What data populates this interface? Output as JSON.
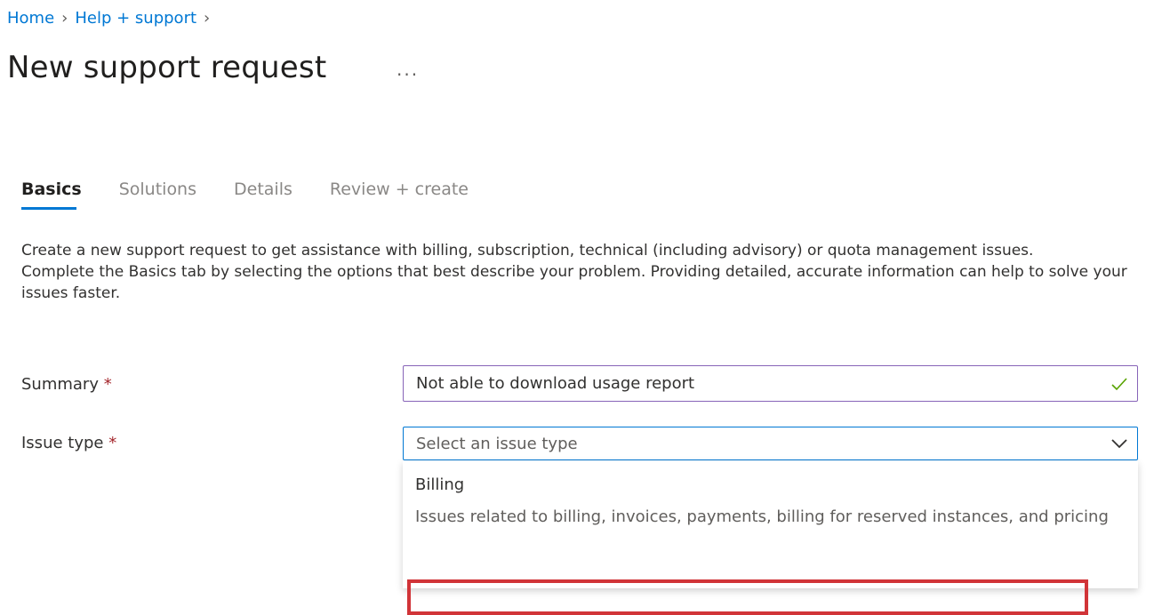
{
  "breadcrumb": {
    "items": [
      "Home",
      "Help + support"
    ],
    "separator": "›"
  },
  "page": {
    "title": "New support request",
    "more_label": "..."
  },
  "tabs": [
    {
      "label": "Basics",
      "active": true
    },
    {
      "label": "Solutions",
      "active": false
    },
    {
      "label": "Details",
      "active": false
    },
    {
      "label": "Review + create",
      "active": false
    }
  ],
  "description": {
    "line1": "Create a new support request to get assistance with billing, subscription, technical (including advisory) or quota management issues.",
    "line2": "Complete the Basics tab by selecting the options that best describe your problem. Providing detailed, accurate information can help to solve your issues faster."
  },
  "form": {
    "summary": {
      "label": "Summary",
      "required_mark": "*",
      "value": "Not able to download usage report"
    },
    "issue_type": {
      "label": "Issue type",
      "required_mark": "*",
      "placeholder": "Select an issue type",
      "options": [
        {
          "title": "Billing",
          "description": "Issues related to billing, invoices, payments, billing for reserved instances, and pricing"
        }
      ]
    }
  },
  "colors": {
    "accent": "#0078d4",
    "required": "#a4262c",
    "valid": "#57a300",
    "highlight": "#d13438"
  },
  "icons": {
    "check": "check-icon",
    "chevron": "chevron-down-icon",
    "more": "more-icon"
  }
}
